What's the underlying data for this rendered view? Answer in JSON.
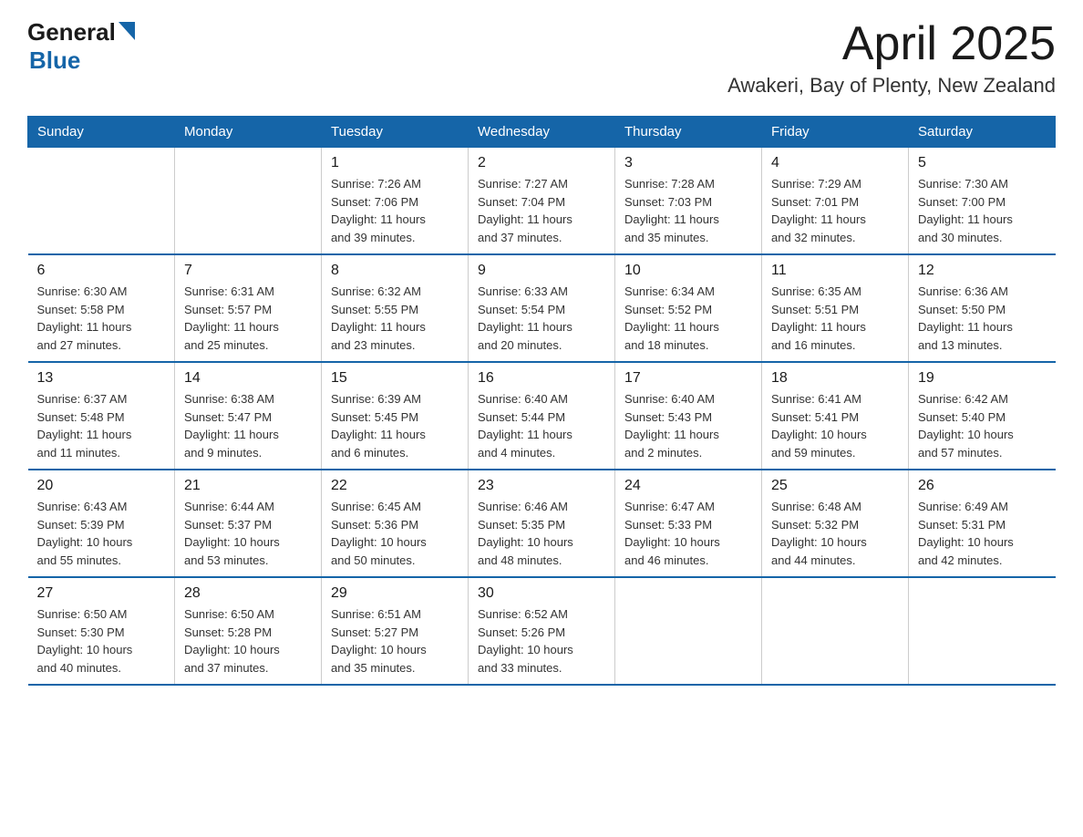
{
  "header": {
    "logo_general": "General",
    "logo_blue": "Blue",
    "month_title": "April 2025",
    "location": "Awakeri, Bay of Plenty, New Zealand"
  },
  "days_of_week": [
    "Sunday",
    "Monday",
    "Tuesday",
    "Wednesday",
    "Thursday",
    "Friday",
    "Saturday"
  ],
  "weeks": [
    [
      {
        "day": "",
        "info": ""
      },
      {
        "day": "",
        "info": ""
      },
      {
        "day": "1",
        "info": "Sunrise: 7:26 AM\nSunset: 7:06 PM\nDaylight: 11 hours\nand 39 minutes."
      },
      {
        "day": "2",
        "info": "Sunrise: 7:27 AM\nSunset: 7:04 PM\nDaylight: 11 hours\nand 37 minutes."
      },
      {
        "day": "3",
        "info": "Sunrise: 7:28 AM\nSunset: 7:03 PM\nDaylight: 11 hours\nand 35 minutes."
      },
      {
        "day": "4",
        "info": "Sunrise: 7:29 AM\nSunset: 7:01 PM\nDaylight: 11 hours\nand 32 minutes."
      },
      {
        "day": "5",
        "info": "Sunrise: 7:30 AM\nSunset: 7:00 PM\nDaylight: 11 hours\nand 30 minutes."
      }
    ],
    [
      {
        "day": "6",
        "info": "Sunrise: 6:30 AM\nSunset: 5:58 PM\nDaylight: 11 hours\nand 27 minutes."
      },
      {
        "day": "7",
        "info": "Sunrise: 6:31 AM\nSunset: 5:57 PM\nDaylight: 11 hours\nand 25 minutes."
      },
      {
        "day": "8",
        "info": "Sunrise: 6:32 AM\nSunset: 5:55 PM\nDaylight: 11 hours\nand 23 minutes."
      },
      {
        "day": "9",
        "info": "Sunrise: 6:33 AM\nSunset: 5:54 PM\nDaylight: 11 hours\nand 20 minutes."
      },
      {
        "day": "10",
        "info": "Sunrise: 6:34 AM\nSunset: 5:52 PM\nDaylight: 11 hours\nand 18 minutes."
      },
      {
        "day": "11",
        "info": "Sunrise: 6:35 AM\nSunset: 5:51 PM\nDaylight: 11 hours\nand 16 minutes."
      },
      {
        "day": "12",
        "info": "Sunrise: 6:36 AM\nSunset: 5:50 PM\nDaylight: 11 hours\nand 13 minutes."
      }
    ],
    [
      {
        "day": "13",
        "info": "Sunrise: 6:37 AM\nSunset: 5:48 PM\nDaylight: 11 hours\nand 11 minutes."
      },
      {
        "day": "14",
        "info": "Sunrise: 6:38 AM\nSunset: 5:47 PM\nDaylight: 11 hours\nand 9 minutes."
      },
      {
        "day": "15",
        "info": "Sunrise: 6:39 AM\nSunset: 5:45 PM\nDaylight: 11 hours\nand 6 minutes."
      },
      {
        "day": "16",
        "info": "Sunrise: 6:40 AM\nSunset: 5:44 PM\nDaylight: 11 hours\nand 4 minutes."
      },
      {
        "day": "17",
        "info": "Sunrise: 6:40 AM\nSunset: 5:43 PM\nDaylight: 11 hours\nand 2 minutes."
      },
      {
        "day": "18",
        "info": "Sunrise: 6:41 AM\nSunset: 5:41 PM\nDaylight: 10 hours\nand 59 minutes."
      },
      {
        "day": "19",
        "info": "Sunrise: 6:42 AM\nSunset: 5:40 PM\nDaylight: 10 hours\nand 57 minutes."
      }
    ],
    [
      {
        "day": "20",
        "info": "Sunrise: 6:43 AM\nSunset: 5:39 PM\nDaylight: 10 hours\nand 55 minutes."
      },
      {
        "day": "21",
        "info": "Sunrise: 6:44 AM\nSunset: 5:37 PM\nDaylight: 10 hours\nand 53 minutes."
      },
      {
        "day": "22",
        "info": "Sunrise: 6:45 AM\nSunset: 5:36 PM\nDaylight: 10 hours\nand 50 minutes."
      },
      {
        "day": "23",
        "info": "Sunrise: 6:46 AM\nSunset: 5:35 PM\nDaylight: 10 hours\nand 48 minutes."
      },
      {
        "day": "24",
        "info": "Sunrise: 6:47 AM\nSunset: 5:33 PM\nDaylight: 10 hours\nand 46 minutes."
      },
      {
        "day": "25",
        "info": "Sunrise: 6:48 AM\nSunset: 5:32 PM\nDaylight: 10 hours\nand 44 minutes."
      },
      {
        "day": "26",
        "info": "Sunrise: 6:49 AM\nSunset: 5:31 PM\nDaylight: 10 hours\nand 42 minutes."
      }
    ],
    [
      {
        "day": "27",
        "info": "Sunrise: 6:50 AM\nSunset: 5:30 PM\nDaylight: 10 hours\nand 40 minutes."
      },
      {
        "day": "28",
        "info": "Sunrise: 6:50 AM\nSunset: 5:28 PM\nDaylight: 10 hours\nand 37 minutes."
      },
      {
        "day": "29",
        "info": "Sunrise: 6:51 AM\nSunset: 5:27 PM\nDaylight: 10 hours\nand 35 minutes."
      },
      {
        "day": "30",
        "info": "Sunrise: 6:52 AM\nSunset: 5:26 PM\nDaylight: 10 hours\nand 33 minutes."
      },
      {
        "day": "",
        "info": ""
      },
      {
        "day": "",
        "info": ""
      },
      {
        "day": "",
        "info": ""
      }
    ]
  ]
}
